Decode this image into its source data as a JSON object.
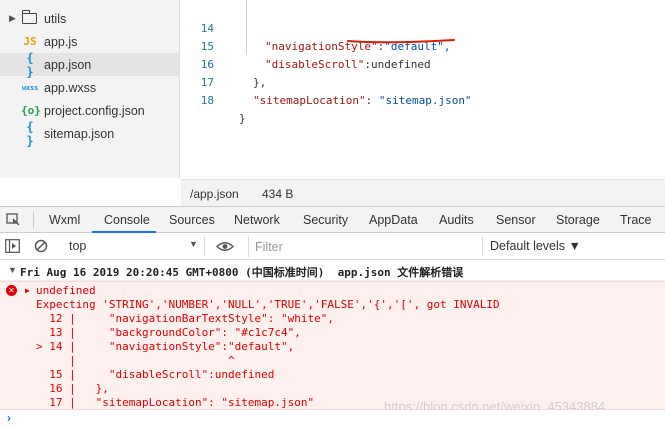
{
  "file_tree": {
    "items": [
      {
        "name": "utils",
        "icon": "folder-icon",
        "kind": "folder"
      },
      {
        "name": "app.js",
        "icon": "js-file-icon",
        "glyph": "JS",
        "kind": "js"
      },
      {
        "name": "app.json",
        "icon": "json-file-icon",
        "glyph": "{ }",
        "kind": "json",
        "selected": true
      },
      {
        "name": "app.wxss",
        "icon": "wxss-file-icon",
        "glyph": "wxss",
        "kind": "wxss"
      },
      {
        "name": "project.config.json",
        "icon": "config-file-icon",
        "glyph": "{o}",
        "kind": "config"
      },
      {
        "name": "sitemap.json",
        "icon": "json-file-icon",
        "glyph": "{ }",
        "kind": "json"
      }
    ]
  },
  "editor": {
    "lines": [
      {
        "num": "14",
        "code": "\"navigationStyle\":\"default\","
      },
      {
        "num": "15",
        "code": "\"disableScroll\":undefined"
      },
      {
        "num": "16",
        "code": "},"
      },
      {
        "num": "17",
        "code": "\"sitemapLocation\": \"sitemap.json\""
      },
      {
        "num": "18",
        "code": "}"
      }
    ]
  },
  "status_bar": {
    "path": "/app.json",
    "size": "434 B"
  },
  "devtools": {
    "tabs": [
      "Wxml",
      "Console",
      "Sources",
      "Network",
      "Security",
      "AppData",
      "Audits",
      "Sensor",
      "Storage",
      "Trace"
    ],
    "active_tab": "Console"
  },
  "console_toolbar": {
    "context": "top",
    "filter_placeholder": "Filter",
    "levels": "Default levels ▼"
  },
  "messages": {
    "warning_header": "Fri Aug 16 2019 20:20:45 GMT+0800 (中国标准时间)  app.json 文件解析错误",
    "error_lines": [
      "undefined",
      "Expecting 'STRING','NUMBER','NULL','TRUE','FALSE','{','[', got INVALID",
      "  12 |     \"navigationBarTextStyle\": \"white\",",
      "  13 |     \"backgroundColor\": \"#c1c7c4\",",
      "> 14 |     \"navigationStyle\":\"default\",",
      "     |                       ^",
      "  15 |     \"disableScroll\":undefined",
      "  16 |   },",
      "  17 |   \"sitemapLocation\": \"sitemap.json\""
    ],
    "watermark": "https://blog.csdn.net/weixin_45343884"
  },
  "prompt_symbol": "›",
  "colors": {
    "error_text": "#e00000",
    "error_bg": "#fff0f0",
    "accent_blue": "#1a73e8",
    "underline_red": "#d81e06"
  }
}
